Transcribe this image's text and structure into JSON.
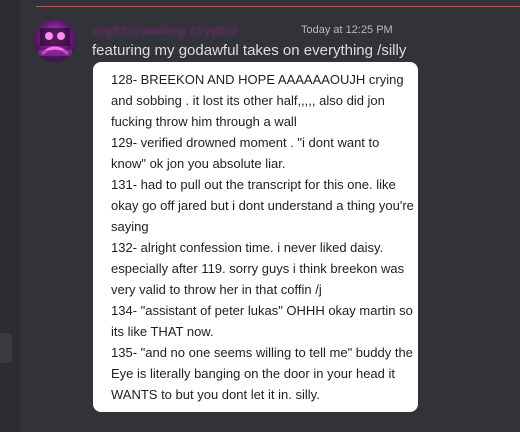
{
  "message": {
    "author": "nightcrawling cryptid",
    "timestamp": "Today at 12:25 PM",
    "text": "featuring my godawful takes on everything /silly"
  },
  "attachment": {
    "entries": [
      "128- BREEKON AND HOPE AAAAAAOUJH crying and sobbing . it lost its other half,,,,, also did jon fucking throw him through a wall",
      "129- verified drowned moment . \"i dont want to know\" ok jon you absolute liar.",
      "131- had to pull out the transcript for this one. like okay go off jared but i dont understand a thing you're saying",
      "132- alright confession time. i never liked daisy. especially after 119. sorry guys i think breekon was very valid to throw her in that coffin /j",
      "134- \"assistant of peter lukas\" OHHH okay martin so its like THAT now.",
      "135- \"and no one seems willing to tell me\" buddy the Eye is literally banging on the door in your head it WANTS to but you dont let it in. silly."
    ]
  },
  "colors": {
    "background": "#313338",
    "divider": "#f23f43",
    "author": "#c11ec1",
    "message_text": "#dbdee1",
    "timestamp": "#b5bac1"
  }
}
